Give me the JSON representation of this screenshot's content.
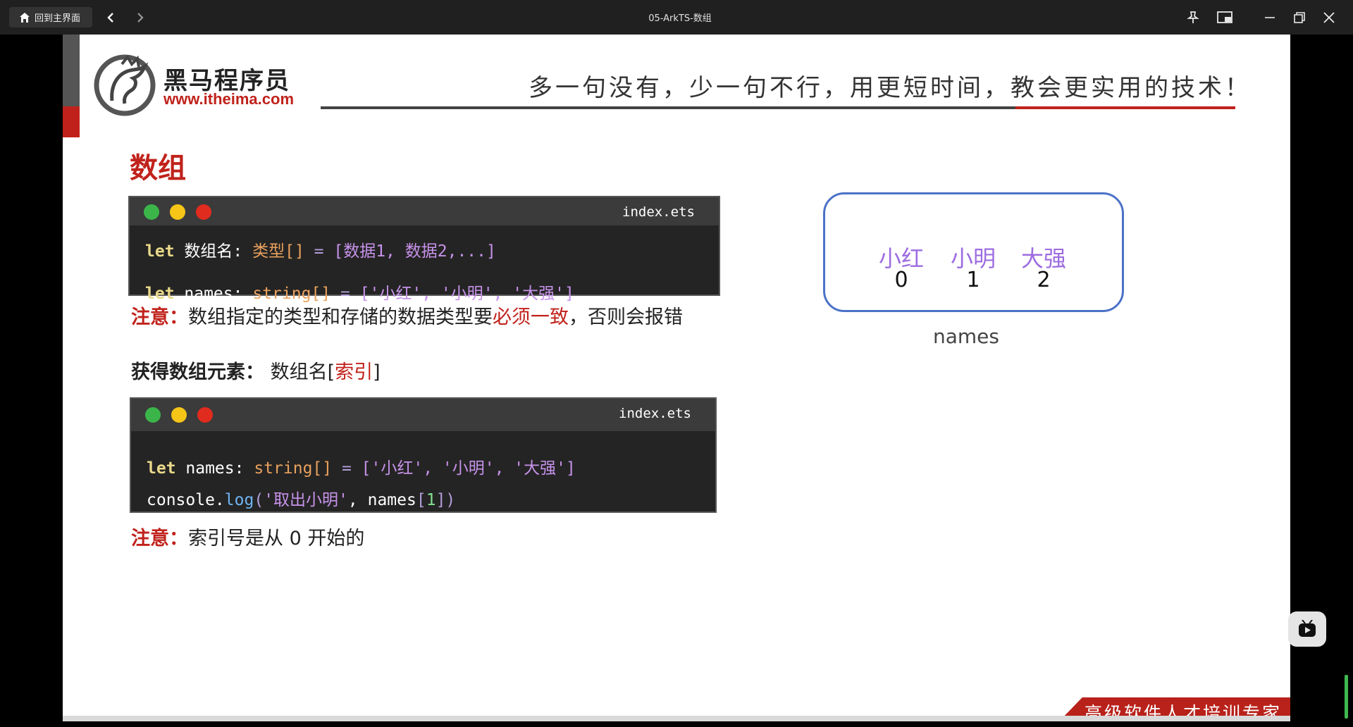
{
  "titlebar": {
    "home_label": "回到主界面",
    "title": "05-ArkTS-数组"
  },
  "slide": {
    "logo": {
      "name_cn": "黑马程序员",
      "url": "www.itheima.com"
    },
    "slogan": "多一句没有，少一句不行，用更短时间，教会更实用的技术！",
    "heading": "数组",
    "code1": {
      "filename": "index.ets",
      "line1": {
        "kw": "let",
        "name": " 数组名",
        "colon": ": ",
        "type": "类型[]",
        "eq": " = ",
        "value": "[数据1, 数据2,...]"
      },
      "line2": {
        "kw": "let",
        "name": " names",
        "colon": ": ",
        "type": "string[]",
        "eq": " = ",
        "value": "['小红', '小明', '大强']"
      }
    },
    "note1": {
      "label": "注意：",
      "text_a": "数组指定的类型和存储的数据类型要",
      "emph": "必须一致",
      "text_b": "，否则会报错"
    },
    "access": {
      "label": "获得数组元素：",
      "text": " 数组名[",
      "emph": "索引",
      "close": "]"
    },
    "code2": {
      "filename": "index.ets",
      "line1": {
        "kw": "let",
        "name": " names",
        "colon": ": ",
        "type": "string[]",
        "eq": " = ",
        "value": "['小红', '小明', '大强']"
      },
      "line2": {
        "obj": "console.",
        "fn": "log",
        "open": "(",
        "str": "'取出小明'",
        "comma": ", ",
        "arr": "names",
        "lb": "[",
        "idx": "1",
        "rb": "])"
      }
    },
    "note2": {
      "label": "注意：",
      "text": "索引号是从 0 开始的"
    },
    "diagram": {
      "items": [
        "小红",
        "小明",
        "大强"
      ],
      "indexes": [
        "0",
        "1",
        "2"
      ],
      "name": "names"
    },
    "banner": "高级软件人才培训专家"
  },
  "colors": {
    "brand_red": "#c0221b",
    "code_bg": "#242424",
    "box_border": "#4c72c7",
    "item_purple": "#9d6ce0"
  }
}
